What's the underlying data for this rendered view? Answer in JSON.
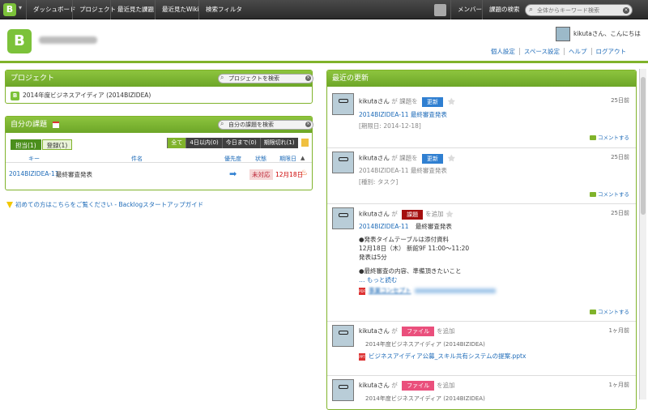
{
  "topbar": {
    "items": [
      "ダッシュボード",
      "プロジェクト",
      "最近見た課題",
      "最近見たWiki",
      "検索フィルタ"
    ],
    "members": "メンバー",
    "issue_search": "課題の検索",
    "search_placeholder": "全体からキーワード検索"
  },
  "header": {
    "greeting": "kikutaさん、こんにちは",
    "links": [
      "個人設定",
      "スペース設定",
      "ヘルプ",
      "ログアウト"
    ]
  },
  "projects": {
    "title": "プロジェクト",
    "search_placeholder": "プロジェクトを検索",
    "items": [
      "2014年度ビジネスアイディア (2014BIZIDEA)"
    ]
  },
  "my_issues": {
    "title": "自分の課題",
    "search_placeholder": "自分の課題を検索",
    "tabs": [
      "担当(1)",
      "登録(1)"
    ],
    "filters": [
      "全て",
      "4日以内(0)",
      "今日まで(0)",
      "期限切れ(1)"
    ],
    "columns": [
      "キー",
      "件名",
      "優先度",
      "状態",
      "期限日"
    ],
    "rows": [
      {
        "key": "2014BIZIDEA-11",
        "subject": "最終審査発表",
        "status": "未対応",
        "due": "12月18日"
      }
    ]
  },
  "notice": "初めての方はこちらをご覧ください - Backlogスタートアップガイド",
  "recent": {
    "title": "最近の更新",
    "comment_label": "コメントする",
    "entries": [
      {
        "user": "kikutaさん",
        "verb": "が 課題を",
        "badge": "更新",
        "badge_color": "blue",
        "when": "25日前",
        "issue": "2014BIZIDEA-11  最終審査発表",
        "detail": "[期限日: 2014-12-18]"
      },
      {
        "user": "kikutaさん",
        "verb": "が 課題を",
        "badge": "更新",
        "badge_color": "blue",
        "when": "25日前",
        "issue": "2014BIZIDEA-11  最終審査発表",
        "detail": "[種別: タスク]"
      },
      {
        "user": "kikutaさん",
        "verb": "が",
        "badge": "課題",
        "badge_suffix": "を追加",
        "badge_color": "red",
        "when": "25日前",
        "issue_key": "2014BIZIDEA-11",
        "issue_title": "最終審査発表",
        "body": [
          "●発表タイムテーブルは添付資料",
          "12月18日（木） 新館9F 11:00～11:20",
          "発表は5分",
          "",
          "●最終審査の内容、準備頂きたいこと"
        ],
        "more": "… もっと読む",
        "attachment": "事業コンセプト"
      },
      {
        "user": "kikutaさん",
        "verb": "が",
        "badge": "ファイル",
        "badge_suffix": "を追加",
        "badge_color": "pink",
        "when": "1ヶ月前",
        "project": "2014年度ビジネスアイディア (2014BIZIDEA)",
        "file": "ビジネスアイディア公募_スキル共有システムの提案.pptx"
      },
      {
        "user": "kikutaさん",
        "verb": "が",
        "badge": "ファイル",
        "badge_suffix": "を追加",
        "badge_color": "pink",
        "when": "1ヶ月前",
        "project": "2014年度ビジネスアイディア (2014BIZIDEA)"
      }
    ]
  }
}
